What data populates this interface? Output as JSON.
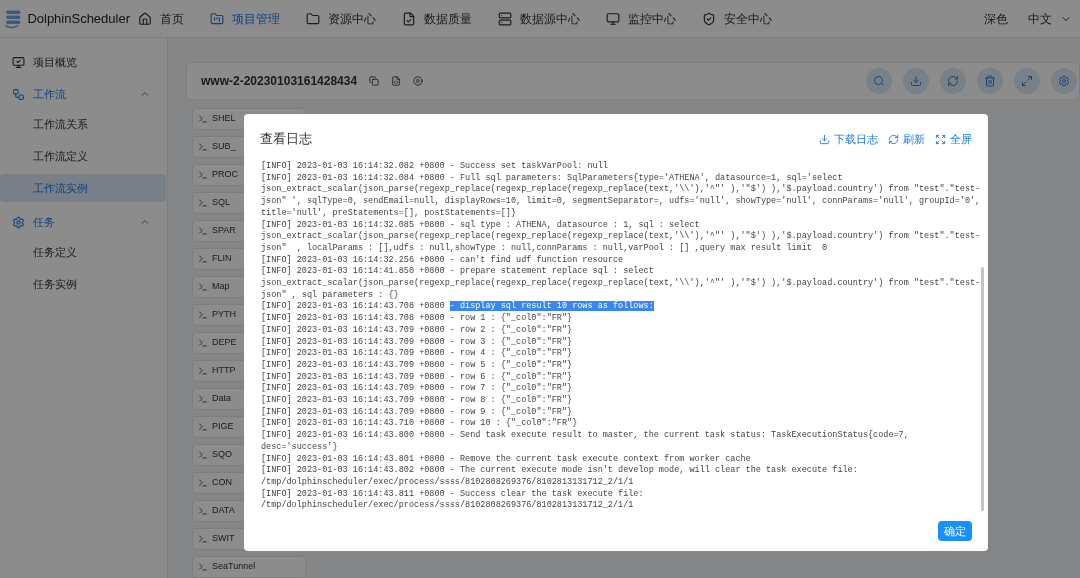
{
  "app": {
    "name": "DolphinScheduler"
  },
  "nav": [
    {
      "label": "首页",
      "selected": false
    },
    {
      "label": "项目管理",
      "selected": true
    },
    {
      "label": "资源中心",
      "selected": false
    },
    {
      "label": "数据质量",
      "selected": false
    },
    {
      "label": "数据源中心",
      "selected": false
    },
    {
      "label": "监控中心",
      "selected": false
    },
    {
      "label": "安全中心",
      "selected": false
    }
  ],
  "nav_right": {
    "theme": "深色",
    "language": "中文"
  },
  "sidebar": [
    {
      "label": "项目概览",
      "selected": false
    },
    {
      "label": "工作流",
      "expanded": true,
      "selected": false,
      "children": [
        {
          "label": "工作流关系",
          "selected": false
        },
        {
          "label": "工作流定义",
          "selected": false
        },
        {
          "label": "工作流实例",
          "selected": true
        }
      ]
    },
    {
      "label": "任务",
      "expanded": true,
      "selected": false,
      "children": [
        {
          "label": "任务定义",
          "selected": false
        },
        {
          "label": "任务实例",
          "selected": false
        }
      ]
    }
  ],
  "header": {
    "title": "www-2-20230103161428434"
  },
  "tasks": [
    "SHEL",
    "SUB_",
    "PROC",
    "SQL",
    "SPAR",
    "FLIN",
    "Map",
    "PYTH",
    "DEPE",
    "HTTP",
    "Data",
    "PIGE",
    "SQO",
    "CON",
    "DATA",
    "SWIT",
    "SeaTunnel"
  ],
  "dialog": {
    "title": "查看日志",
    "actions": [
      "下载日志",
      "刷新",
      "全屏"
    ],
    "log_lines": [
      {
        "text": "[INFO] 2023-01-03 16:14:32.082 +0800 - Success set taskVarPool: null"
      },
      {
        "text": "[INFO] 2023-01-03 16:14:32.084 +0800 - Full sql parameters: SqlParameters{type='ATHENA', datasource=1, sql='select"
      },
      {
        "text": "json_extract_scalar(json_parse(regexp_replace(regexp_replace(regexp_replace(text,'\\\\'),'^\"' ),'\"$') ),'$.payload.country') from \"test\".\"test-"
      },
      {
        "text": "json\" ', sqlType=0, sendEmail=null, displayRows=10, limit=0, segmentSeparator=, udfs='null', showType='null', connParams='null', groupId='0',"
      },
      {
        "text": "title='null', preStatements=[], postStatements=[]}"
      },
      {
        "text": "[INFO] 2023-01-03 16:14:32.085 +0800 - sql type : ATHENA, datasource : 1, sql : select"
      },
      {
        "text": "json_extract_scalar(json_parse(regexp_replace(regexp_replace(regexp_replace(text,'\\\\'),'^\"' ),'\"$') ),'$.payload.country') from \"test\".\"test-"
      },
      {
        "text": "json\"  , localParams : [],udfs : null,showType : null,connParams : null,varPool : [] ,query max result limit  0"
      },
      {
        "text": "[INFO] 2023-01-03 16:14:32.256 +0800 - can't find udf function resource"
      },
      {
        "text": "[INFO] 2023-01-03 16:14:41.850 +0800 - prepare statement replace sql : select"
      },
      {
        "text": "json_extract_scalar(json_parse(regexp_replace(regexp_replace(regexp_replace(text,'\\\\'),'^\"' ),'\"$') ),'$.payload.country') from \"test\".\"test-"
      },
      {
        "text": "json\" , sql parameters : {}"
      },
      {
        "text": "[INFO] 2023-01-03 16:14:43.708 +0800 ",
        "selection": "- display sql result 10 rows as follows:"
      },
      {
        "text": "[INFO] 2023-01-03 16:14:43.708 +0800 - row 1 : {\"_col0\":\"FR\"}"
      },
      {
        "text": "[INFO] 2023-01-03 16:14:43.709 +0800 - row 2 : {\"_col0\":\"FR\"}"
      },
      {
        "text": "[INFO] 2023-01-03 16:14:43.709 +0800 - row 3 : {\"_col0\":\"FR\"}"
      },
      {
        "text": "[INFO] 2023-01-03 16:14:43.709 +0800 - row 4 : {\"_col0\":\"FR\"}"
      },
      {
        "text": "[INFO] 2023-01-03 16:14:43.709 +0800 - row 5 : {\"_col0\":\"FR\"}"
      },
      {
        "text": "[INFO] 2023-01-03 16:14:43.709 +0800 - row 6 : {\"_col0\":\"FR\"}"
      },
      {
        "text": "[INFO] 2023-01-03 16:14:43.709 +0800 - row 7 : {\"_col0\":\"FR\"}"
      },
      {
        "text": "[INFO] 2023-01-03 16:14:43.709 +0800 - row 8 : {\"_col0\":\"FR\"}"
      },
      {
        "text": "[INFO] 2023-01-03 16:14:43.709 +0800 - row 9 : {\"_col0\":\"FR\"}"
      },
      {
        "text": "[INFO] 2023-01-03 16:14:43.710 +0800 - row 10 : {\"_col0\":\"FR\"}"
      },
      {
        "text": "[INFO] 2023-01-03 16:14:43.800 +0800 - Send task execute result to master, the current task status: TaskExecutionStatus{code=7,"
      },
      {
        "text": "desc='success'}"
      },
      {
        "text": "[INFO] 2023-01-03 16:14:43.801 +0800 - Remove the current task execute context from worker cache"
      },
      {
        "text": "[INFO] 2023-01-03 16:14:43.802 +0800 - The current execute mode isn't develop mode, will clear the task execute file:"
      },
      {
        "text": "/tmp/dolphinscheduler/exec/process/ssss/8102808269376/8102813131712_2/1/1"
      },
      {
        "text": "[INFO] 2023-01-03 16:14:43.811 +0800 - Success clear the task execute file:"
      },
      {
        "text": "/tmp/dolphinscheduler/exec/process/ssss/8102808269376/8102813131712_2/1/1"
      }
    ],
    "confirm": "确定"
  }
}
